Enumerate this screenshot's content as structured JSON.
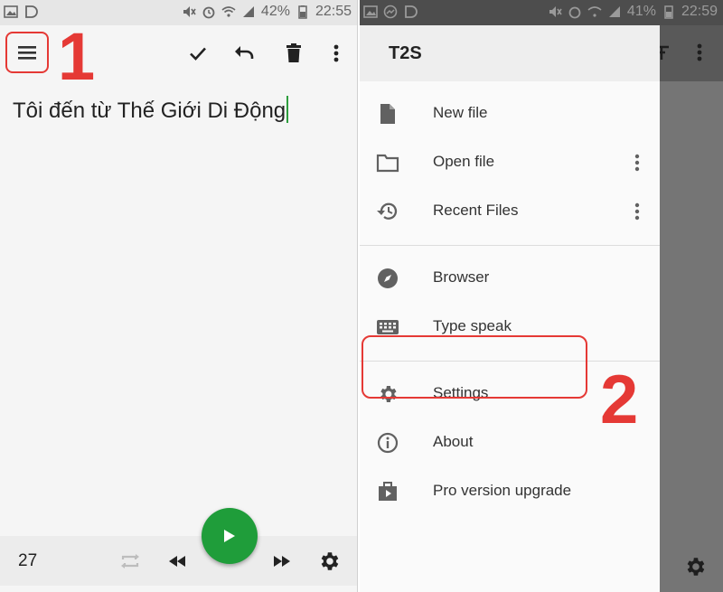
{
  "status_left": {
    "battery": "42%",
    "time": "22:55"
  },
  "status_right": {
    "battery": "41%",
    "time": "22:59"
  },
  "toolbar": {
    "menu_icon": "menu-icon",
    "actions": [
      "check-icon",
      "undo-icon",
      "delete-icon",
      "more-vert-icon"
    ]
  },
  "markers": {
    "step1": "1",
    "step2": "2"
  },
  "editor": {
    "text": "Tôi đến từ Thế Giới Di Động"
  },
  "bottom_bar": {
    "count": "27",
    "icons": [
      "repeat-icon",
      "rewind-icon",
      "play-icon",
      "fast-forward-icon",
      "settings-icon"
    ]
  },
  "drawer": {
    "title": "T2S",
    "groups": [
      [
        {
          "label": "New file",
          "icon": "file-icon",
          "more": false
        },
        {
          "label": "Open file",
          "icon": "folder-icon",
          "more": true
        },
        {
          "label": "Recent Files",
          "icon": "history-icon",
          "more": true
        }
      ],
      [
        {
          "label": "Browser",
          "icon": "compass-icon",
          "more": false
        },
        {
          "label": "Type speak",
          "icon": "keyboard-icon",
          "more": false
        }
      ],
      [
        {
          "label": "Settings",
          "icon": "settings-icon",
          "more": false
        },
        {
          "label": "About",
          "icon": "info-icon",
          "more": false
        },
        {
          "label": "Pro version upgrade",
          "icon": "briefcase-play-icon",
          "more": false
        }
      ]
    ]
  },
  "colors": {
    "accent_green": "#1f9d3a",
    "highlight_red": "#e53935",
    "icon_gray": "#616161"
  }
}
